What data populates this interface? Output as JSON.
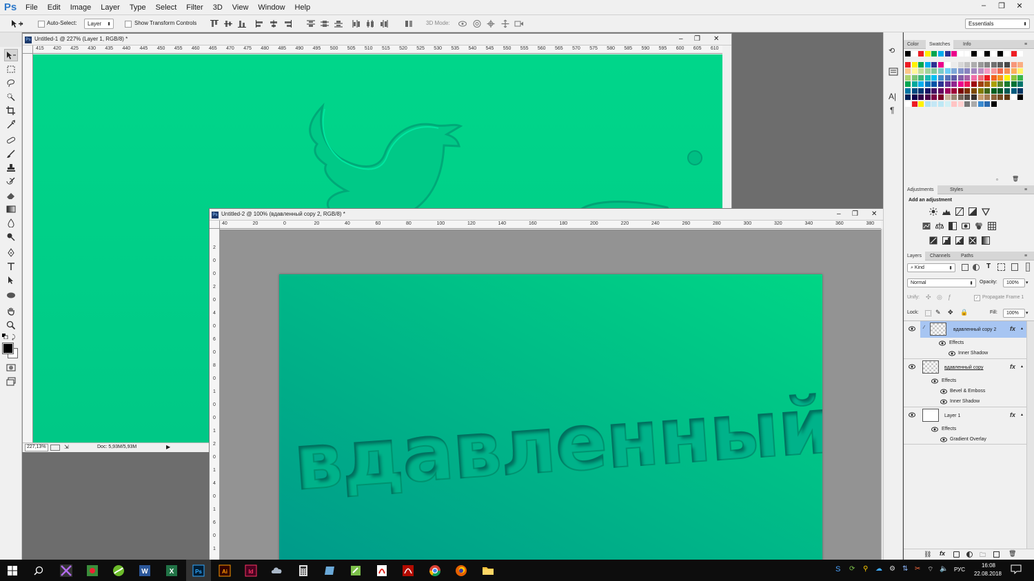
{
  "app": {
    "logo": "Ps"
  },
  "menu": [
    "File",
    "Edit",
    "Image",
    "Layer",
    "Type",
    "Select",
    "Filter",
    "3D",
    "View",
    "Window",
    "Help"
  ],
  "window_controls": {
    "minimize": "–",
    "restore": "❐",
    "close": "✕"
  },
  "options": {
    "auto_select_label": "Auto-Select:",
    "auto_select_value": "Layer",
    "transform_label": "Show Transform Controls",
    "mode_3d_label": "3D Mode:",
    "workspace": "Essentials"
  },
  "doc1": {
    "title": "Untitled-1 @ 227% (Layer 1, RGB/8) *",
    "zoom": "227,13%",
    "doc_size": "Doc: 5,93M/5,93M",
    "ruler": [
      "415",
      "420",
      "425",
      "430",
      "435",
      "440",
      "445",
      "450",
      "455",
      "460",
      "465",
      "470",
      "475",
      "480",
      "485",
      "490",
      "495",
      "500",
      "505",
      "510",
      "515",
      "520",
      "525",
      "530",
      "535",
      "540",
      "545",
      "550",
      "555",
      "560",
      "565",
      "570",
      "575",
      "580",
      "585",
      "590",
      "595",
      "600",
      "605",
      "610"
    ],
    "colors": {
      "canvas": "#00d68a"
    }
  },
  "doc2": {
    "title": "Untitled-2 @ 100% (вдавленный copy 2, RGB/8) *",
    "ruler": [
      "40",
      "20",
      "0",
      "20",
      "40",
      "60",
      "80",
      "100",
      "120",
      "140",
      "160",
      "180",
      "200",
      "220",
      "240",
      "260",
      "280",
      "300",
      "320",
      "340",
      "360",
      "380"
    ],
    "vruler": [
      "2",
      "0",
      "0",
      "2",
      "0",
      "4",
      "0",
      "6",
      "0",
      "8",
      "0",
      "1",
      "0",
      "0",
      "1",
      "2",
      "0",
      "1",
      "4",
      "0",
      "1",
      "6",
      "0",
      "1"
    ],
    "canvas_text": "вдавленный",
    "colors": {
      "gradient_start": "#009a8a",
      "gradient_end": "#00d685"
    }
  },
  "panels": {
    "swatch_tabs": [
      "Color",
      "Swatches",
      "Info"
    ],
    "adjust_tabs": [
      "Adjustments",
      "Styles"
    ],
    "adjust_title": "Add an adjustment",
    "layer_tabs": [
      "Layers",
      "Channels",
      "Paths"
    ],
    "kind": "Kind",
    "blend": "Normal",
    "opacity_label": "Opacity:",
    "opacity": "100%",
    "unify_label": "Unify:",
    "propagate": "Propagate Frame 1",
    "lock_label": "Lock:",
    "fill_label": "Fill:",
    "fill": "100%",
    "fx": "fx",
    "layers": [
      {
        "name": "вдавленный copy 2",
        "effects_label": "Effects",
        "effects": [
          "Inner Shadow"
        ]
      },
      {
        "name": "вдавленный copy",
        "effects_label": "Effects",
        "effects": [
          "Bevel & Emboss",
          "Inner Shadow"
        ]
      },
      {
        "name": "Layer 1",
        "effects_label": "Effects",
        "effects": [
          "Gradient Overlay"
        ]
      }
    ]
  },
  "taskbar": {
    "lang": "РУС",
    "time": "16:08",
    "date": "22.08.2018"
  }
}
